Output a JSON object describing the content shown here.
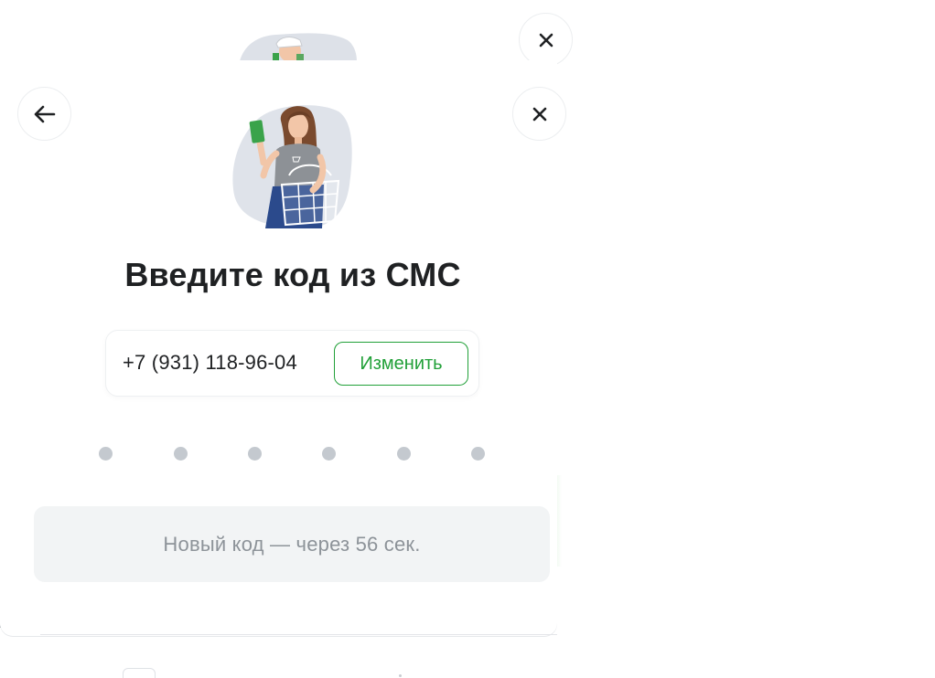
{
  "background_modal": {
    "close_icon": "close-icon"
  },
  "modal": {
    "back_icon": "arrow-left-icon",
    "close_icon": "close-icon",
    "title": "Введите код из СМС",
    "phone": {
      "number": "+7 (931) 118-96-04",
      "change_label": "Изменить"
    },
    "code": {
      "length": 6,
      "entered": ""
    },
    "resend": {
      "text": "Новый код — через 56 сек."
    }
  },
  "colors": {
    "accent_green": "#21a038",
    "title": "#1f2123",
    "placeholder_dot": "#c4c9cf",
    "resend_bg": "#f2f4f5",
    "resend_text": "#8d9399"
  }
}
